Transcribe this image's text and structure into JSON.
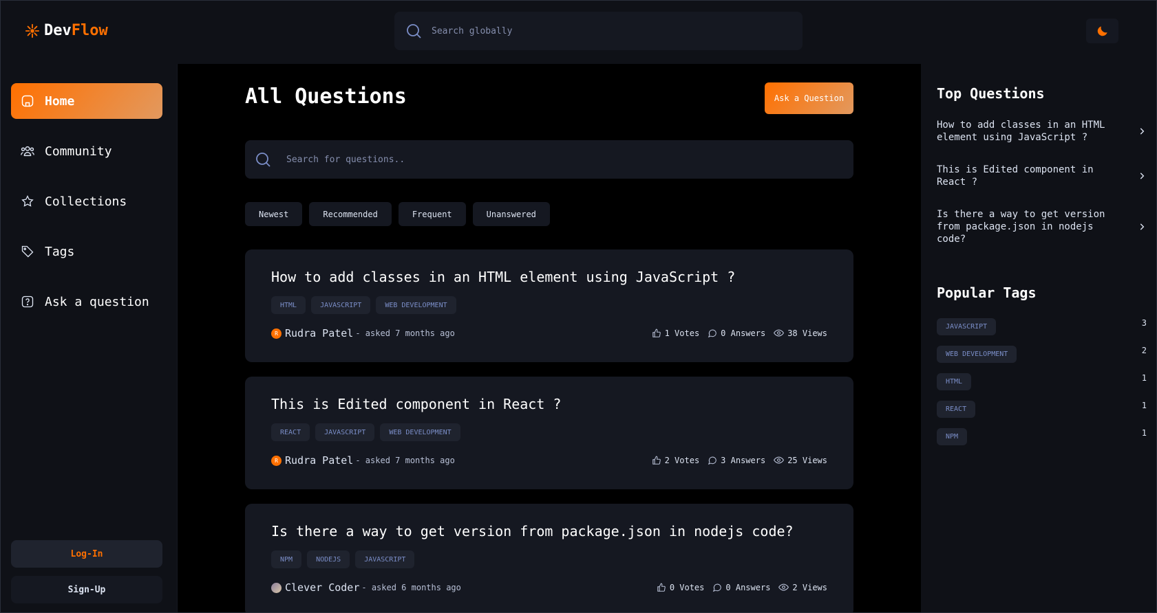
{
  "brand": {
    "name_part1": "Dev",
    "name_part2": "Flow",
    "accent": "#ff7000"
  },
  "global_search": {
    "placeholder": "Search globally"
  },
  "theme_toggle": {
    "icon": "moon-icon"
  },
  "sidebar": {
    "items": [
      {
        "label": "Home",
        "icon": "home-icon",
        "active": true
      },
      {
        "label": "Community",
        "icon": "users-icon"
      },
      {
        "label": "Collections",
        "icon": "star-icon"
      },
      {
        "label": "Tags",
        "icon": "tag-icon"
      },
      {
        "label": "Ask a question",
        "icon": "question-icon"
      }
    ],
    "login": "Log-In",
    "signup": "Sign-Up"
  },
  "main": {
    "title": "All Questions",
    "ask_button": "Ask a Question",
    "search_placeholder": "Search for questions..",
    "filters": [
      "Newest",
      "Recommended",
      "Frequent",
      "Unanswered"
    ],
    "questions": [
      {
        "title": "How to add classes in an HTML element using JavaScript ?",
        "tags": [
          "HTML",
          "JAVASCRIPT",
          "WEB DEVELOPMENT"
        ],
        "author": "Rudra Patel",
        "avatar_letter": "R",
        "asked": "- asked 7 months ago",
        "votes": "1 Votes",
        "answers": "0 Answers",
        "views": "38 Views"
      },
      {
        "title": "This is Edited component in React ?",
        "tags": [
          "REACT",
          "JAVASCRIPT",
          "WEB DEVELOPMENT"
        ],
        "author": "Rudra Patel",
        "avatar_letter": "R",
        "asked": "- asked 7 months ago",
        "votes": "2 Votes",
        "answers": "3 Answers",
        "views": "25 Views"
      },
      {
        "title": "Is there a way to get version from package.json in nodejs code?",
        "tags": [
          "NPM",
          "NODEJS",
          "JAVASCRIPT"
        ],
        "author": "Clever Coder",
        "avatar_letter": "",
        "asked": "- asked 6 months ago",
        "votes": "0 Votes",
        "answers": "0 Answers",
        "views": "2 Views"
      }
    ]
  },
  "right_sidebar": {
    "top_heading": "Top Questions",
    "top_questions": [
      "How to add classes in an HTML element using JavaScript ?",
      "This is Edited component in React ?",
      "Is there a way to get version from package.json in nodejs code?"
    ],
    "tags_heading": "Popular Tags",
    "popular_tags": [
      {
        "name": "JAVASCRIPT",
        "count": "3"
      },
      {
        "name": "WEB DEVELOPMENT",
        "count": "2"
      },
      {
        "name": "HTML",
        "count": "1"
      },
      {
        "name": "REACT",
        "count": "1"
      },
      {
        "name": "NPM",
        "count": "1"
      }
    ]
  }
}
